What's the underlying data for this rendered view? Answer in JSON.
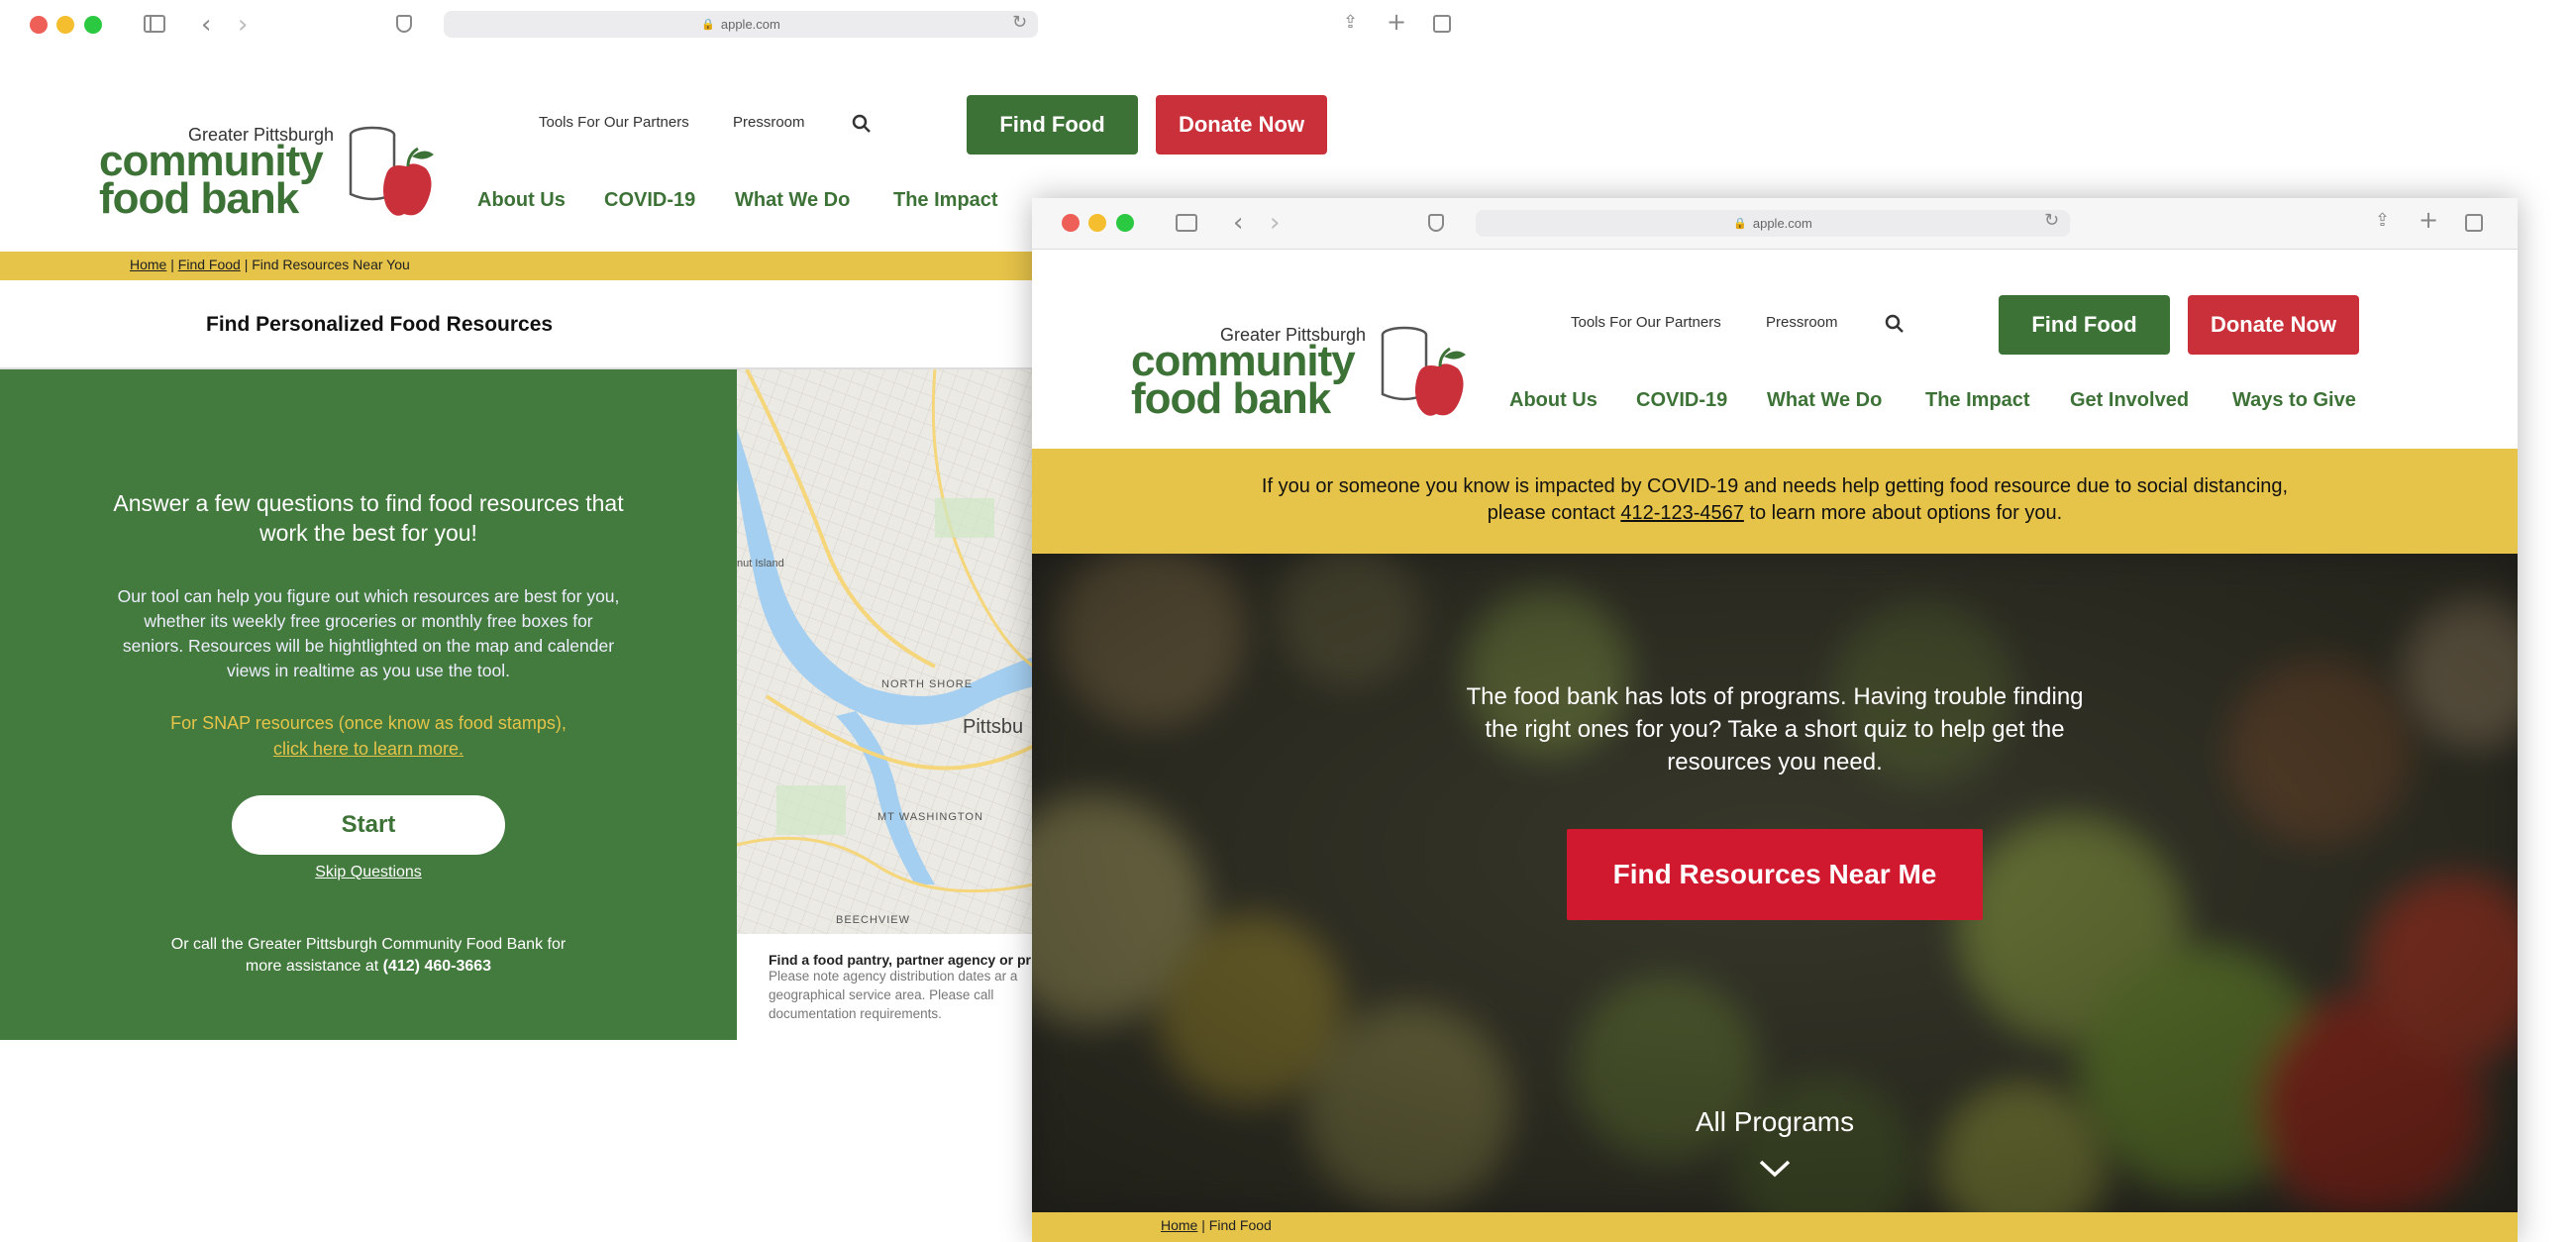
{
  "back_window": {
    "url": "apple.com",
    "logo": {
      "small": "Greater Pittsburgh",
      "line1": "community",
      "line2": "food bank"
    },
    "util_links": [
      "Tools For Our Partners",
      "Pressroom"
    ],
    "find_food": "Find Food",
    "donate": "Donate Now",
    "nav": [
      "About Us",
      "COVID-19",
      "What We Do",
      "The Impact"
    ],
    "breadcrumb": {
      "home": "Home",
      "sep1": " | ",
      "find": "Find Food",
      "sep2": " | ",
      "current": "Find Resources Near You"
    },
    "section_title": "Find Personalized Food Resources",
    "panel": {
      "heading": "Answer a few questions to find food resources that work the best for you!",
      "body": "Our tool can help you figure out which resources are best for you, whether its weekly free groceries or monthly free boxes for seniors. Resources will be hightlighted on the map and calender views in realtime as you use the tool.",
      "snap_text": "For SNAP resources (once know as food stamps),",
      "snap_link": "click here to learn more.",
      "start": "Start",
      "skip": "Skip Questions",
      "call_text": "Or call the Greater Pittsburgh Community Food Bank for more assistance at",
      "phone": "(412) 460-3663"
    },
    "map": {
      "labels": [
        "North Shore",
        "Mt Washington",
        "Beechview",
        "Pittsbu",
        "nut Island"
      ],
      "caption_title": "Find a food pantry, partner agency or pr",
      "caption_body": "Please note agency distribution dates ar a geographical service area. Please call documentation requirements."
    }
  },
  "front_window": {
    "url": "apple.com",
    "logo": {
      "small": "Greater Pittsburgh",
      "line1": "community",
      "line2": "food bank"
    },
    "util_links": [
      "Tools For Our Partners",
      "Pressroom"
    ],
    "find_food": "Find Food",
    "donate": "Donate Now",
    "nav": [
      "About Us",
      "COVID-19",
      "What We Do",
      "The Impact",
      "Get Involved",
      "Ways to Give"
    ],
    "alert_line1": "If you or someone you know is impacted by COVID-19 and needs help getting food resource due to social distancing,",
    "alert_pre": "please contact ",
    "alert_phone": "412-123-4567",
    "alert_post": " to learn more about options for you.",
    "hero_text": "The food bank has lots of programs. Having trouble finding the right ones for you? Take a short quiz to help get the resources you need.",
    "hero_button": "Find Resources Near Me",
    "all_programs": "All Programs",
    "breadcrumb": {
      "home": "Home",
      "sep": " | ",
      "current": "Find Food"
    }
  },
  "colors": {
    "green": "#3d7237",
    "red": "#c9303a",
    "yellow": "#e6c349",
    "hero_red": "#d0192e"
  }
}
